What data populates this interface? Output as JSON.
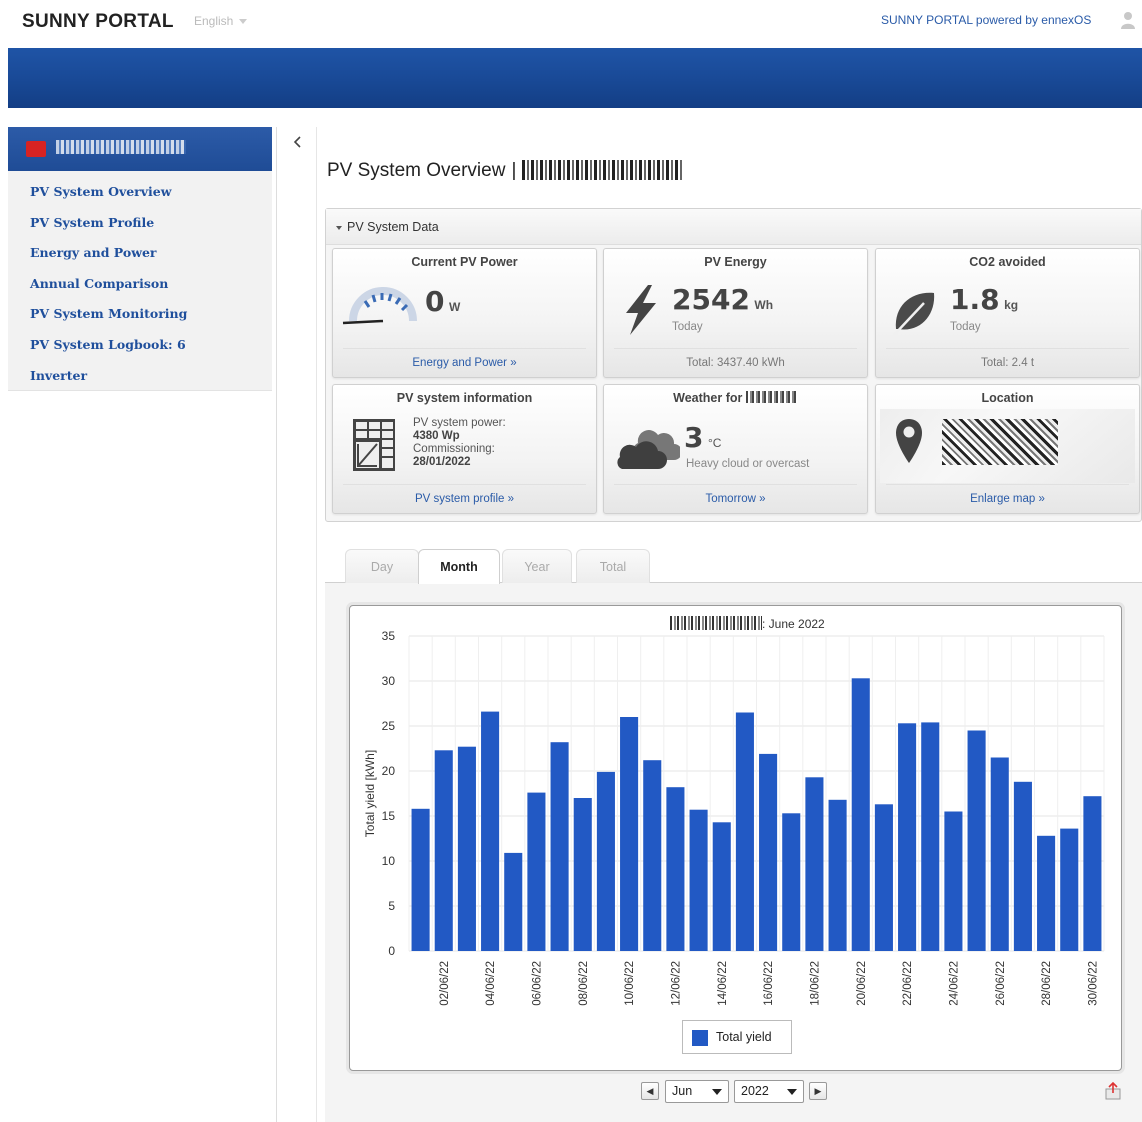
{
  "header": {
    "logo": "SUNNY PORTAL",
    "language": "English",
    "powered_by": "SUNNY PORTAL powered by ennexOS"
  },
  "sidebar": {
    "items": [
      {
        "label": "PV System Overview"
      },
      {
        "label": "PV System Profile"
      },
      {
        "label": "Energy and Power"
      },
      {
        "label": "Annual Comparison"
      },
      {
        "label": "PV System Monitoring"
      },
      {
        "label": "PV System Logbook: 6"
      },
      {
        "label": "Inverter"
      }
    ]
  },
  "page": {
    "title": "PV System Overview",
    "title_sep": "|"
  },
  "system_data": {
    "heading": "PV System Data",
    "tiles": {
      "current_power": {
        "title": "Current PV Power",
        "value": "0",
        "unit": "W",
        "link": "Energy and Power »"
      },
      "energy": {
        "title": "PV Energy",
        "value": "2542",
        "unit": "Wh",
        "sub": "Today",
        "footer": "Total: 3437.40 kWh"
      },
      "co2": {
        "title": "CO2 avoided",
        "value": "1.8",
        "unit": "kg",
        "sub": "Today",
        "footer": "Total: 2.4 t"
      },
      "info": {
        "title": "PV system information",
        "power_label": "PV system power:",
        "power_value": "4380 Wp",
        "commission_label": "Commissioning:",
        "commission_value": "28/01/2022",
        "link": "PV system profile »"
      },
      "weather": {
        "title": "Weather for",
        "value": "3",
        "unit": "°C",
        "desc": "Heavy cloud or overcast",
        "link": "Tomorrow »"
      },
      "location": {
        "title": "Location",
        "link": "Enlarge map »"
      }
    }
  },
  "tabs": [
    {
      "label": "Day",
      "active": false
    },
    {
      "label": "Month",
      "active": true
    },
    {
      "label": "Year",
      "active": false
    },
    {
      "label": "Total",
      "active": false
    }
  ],
  "chart_nav": {
    "month": "Jun",
    "year": "2022",
    "prev": "◀",
    "next": "▶"
  },
  "colors": {
    "accent": "#1f54a6",
    "bar": "#2259c4",
    "link": "#2a5ba8"
  },
  "chart_data": {
    "type": "bar",
    "title": ": June 2022",
    "ylabel": "Total yield [kWh]",
    "ylim": [
      0,
      35
    ],
    "yticks": [
      0,
      5,
      10,
      15,
      20,
      25,
      30,
      35
    ],
    "categories": [
      "01/06/22",
      "02/06/22",
      "03/06/22",
      "04/06/22",
      "05/06/22",
      "06/06/22",
      "07/06/22",
      "08/06/22",
      "09/06/22",
      "10/06/22",
      "11/06/22",
      "12/06/22",
      "13/06/22",
      "14/06/22",
      "15/06/22",
      "16/06/22",
      "17/06/22",
      "18/06/22",
      "19/06/22",
      "20/06/22",
      "21/06/22",
      "22/06/22",
      "23/06/22",
      "24/06/22",
      "25/06/22",
      "26/06/22",
      "27/06/22",
      "28/06/22",
      "29/06/22",
      "30/06/22"
    ],
    "tick_labels": [
      "02/06/22",
      "04/06/22",
      "06/06/22",
      "08/06/22",
      "10/06/22",
      "12/06/22",
      "14/06/22",
      "16/06/22",
      "18/06/22",
      "20/06/22",
      "22/06/22",
      "24/06/22",
      "26/06/22",
      "28/06/22",
      "30/06/22"
    ],
    "series": [
      {
        "name": "Total yield",
        "values": [
          15.8,
          22.3,
          22.7,
          26.6,
          10.9,
          17.6,
          23.2,
          17.0,
          19.9,
          26.0,
          21.2,
          18.2,
          15.7,
          14.3,
          26.5,
          21.9,
          15.3,
          19.3,
          16.8,
          30.3,
          16.3,
          25.3,
          25.4,
          15.5,
          24.5,
          21.5,
          18.8,
          12.8,
          13.6,
          17.2
        ]
      }
    ]
  }
}
